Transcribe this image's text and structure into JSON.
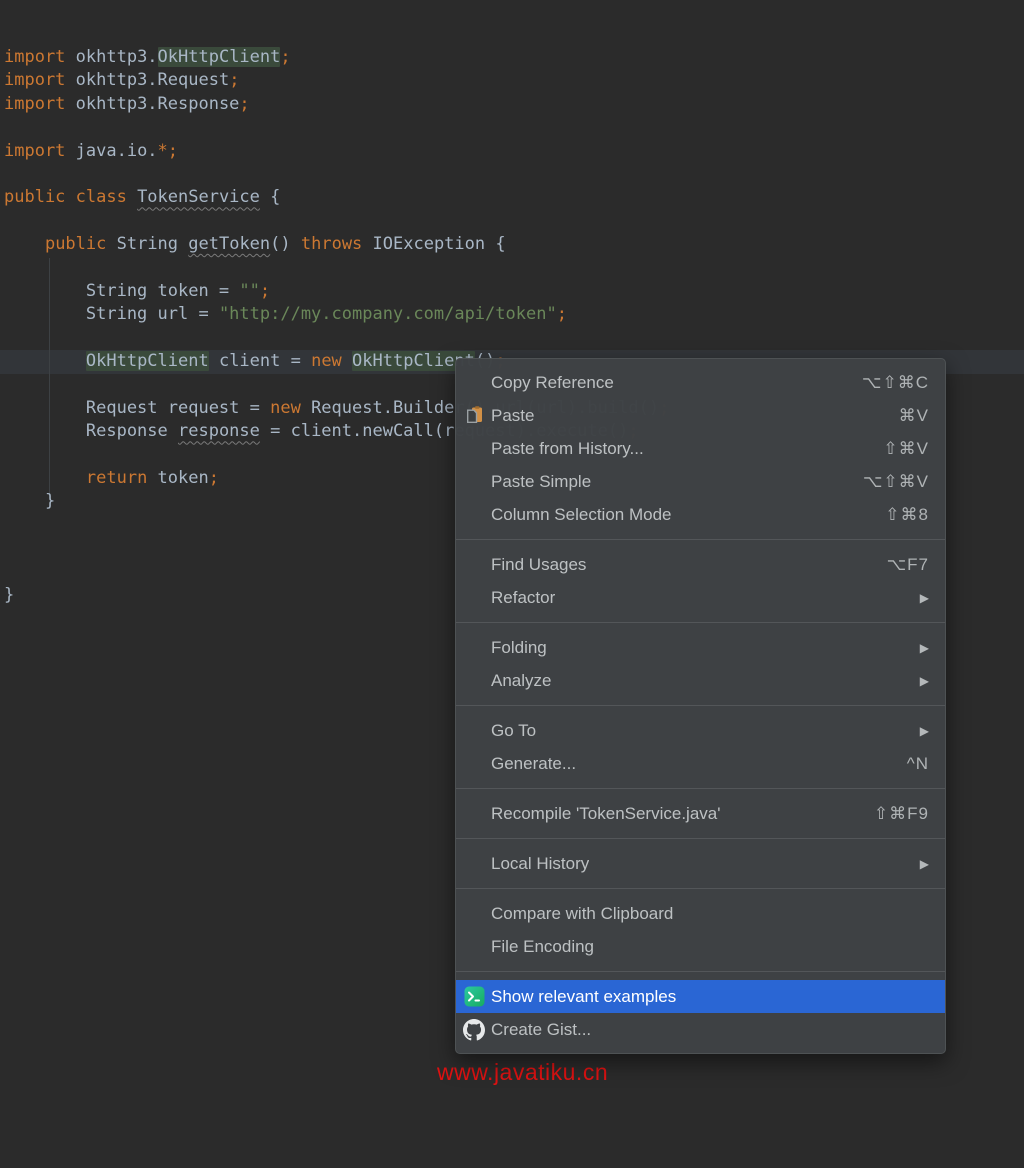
{
  "editor": {
    "background": "#2b2b2b",
    "caret_line_index": 13,
    "highlight_color": "#3a4a3b",
    "lines": [
      {
        "segments": [
          {
            "t": "import ",
            "c": "k"
          },
          {
            "t": "okhttp3.",
            "c": "p"
          },
          {
            "t": "OkHttpClient",
            "c": "p",
            "occ": true
          },
          {
            "t": ";",
            "c": "k"
          }
        ]
      },
      {
        "segments": [
          {
            "t": "import ",
            "c": "k"
          },
          {
            "t": "okhttp3.Request",
            "c": "p"
          },
          {
            "t": ";",
            "c": "k"
          }
        ]
      },
      {
        "segments": [
          {
            "t": "import ",
            "c": "k"
          },
          {
            "t": "okhttp3.Response",
            "c": "p"
          },
          {
            "t": ";",
            "c": "k"
          }
        ]
      },
      {
        "segments": []
      },
      {
        "segments": [
          {
            "t": "import ",
            "c": "k"
          },
          {
            "t": "java.io.",
            "c": "p"
          },
          {
            "t": "*;",
            "c": "k"
          }
        ]
      },
      {
        "segments": []
      },
      {
        "segments": [
          {
            "t": "public class ",
            "c": "k"
          },
          {
            "t": "TokenService",
            "c": "p",
            "wavy": true
          },
          {
            "t": " {",
            "c": "p"
          }
        ]
      },
      {
        "segments": []
      },
      {
        "segments": [
          {
            "t": "    ",
            "c": "p"
          },
          {
            "t": "public ",
            "c": "k"
          },
          {
            "t": "String ",
            "c": "p"
          },
          {
            "t": "getToken",
            "c": "p",
            "wavy": true
          },
          {
            "t": "() ",
            "c": "p"
          },
          {
            "t": "throws ",
            "c": "k"
          },
          {
            "t": "IOException {",
            "c": "p"
          }
        ]
      },
      {
        "segments": []
      },
      {
        "segments": [
          {
            "t": "        String token = ",
            "c": "p"
          },
          {
            "t": "\"\"",
            "c": "s"
          },
          {
            "t": ";",
            "c": "k"
          }
        ]
      },
      {
        "segments": [
          {
            "t": "        String url = ",
            "c": "p"
          },
          {
            "t": "\"http://my.company.com/api/token\"",
            "c": "s"
          },
          {
            "t": ";",
            "c": "k"
          }
        ]
      },
      {
        "segments": []
      },
      {
        "segments": [
          {
            "t": "        ",
            "c": "p"
          },
          {
            "t": "OkHttpClient",
            "c": "p",
            "occ": true
          },
          {
            "t": " client = ",
            "c": "p"
          },
          {
            "t": "new ",
            "c": "k"
          },
          {
            "t": "OkHttpClient",
            "c": "p",
            "occ": true
          },
          {
            "t": "()",
            "c": "p"
          },
          {
            "t": ";",
            "c": "k"
          }
        ]
      },
      {
        "segments": []
      },
      {
        "segments": [
          {
            "t": "        Request request = ",
            "c": "p"
          },
          {
            "t": "new ",
            "c": "k"
          },
          {
            "t": "Request.Builder().url(url).build()",
            "c": "p"
          },
          {
            "t": ";",
            "c": "k"
          }
        ]
      },
      {
        "segments": [
          {
            "t": "        Response ",
            "c": "p"
          },
          {
            "t": "response",
            "c": "p",
            "wavy": true
          },
          {
            "t": " = client.newCall(request).execute()",
            "c": "p"
          },
          {
            "t": ";",
            "c": "k"
          }
        ]
      },
      {
        "segments": []
      },
      {
        "segments": [
          {
            "t": "        ",
            "c": "p"
          },
          {
            "t": "return ",
            "c": "k"
          },
          {
            "t": "token",
            "c": "p"
          },
          {
            "t": ";",
            "c": "k"
          }
        ]
      },
      {
        "segments": [
          {
            "t": "    }",
            "c": "p"
          }
        ]
      },
      {
        "segments": []
      },
      {
        "segments": []
      },
      {
        "segments": []
      },
      {
        "segments": [
          {
            "t": "}",
            "c": "p"
          }
        ]
      }
    ]
  },
  "context_menu": {
    "selection_color": "#2a66d4",
    "groups": [
      {
        "items": [
          {
            "label": "Copy Reference",
            "shortcut": "⌥⇧⌘C"
          },
          {
            "label": "Paste",
            "icon": "paste-icon",
            "shortcut": "⌘V"
          },
          {
            "label": "Paste from History...",
            "shortcut": "⇧⌘V"
          },
          {
            "label": "Paste Simple",
            "shortcut": "⌥⇧⌘V"
          },
          {
            "label": "Column Selection Mode",
            "shortcut": "⇧⌘8"
          }
        ]
      },
      {
        "items": [
          {
            "label": "Find Usages",
            "shortcut": "⌥F7"
          },
          {
            "label": "Refactor",
            "submenu": true
          }
        ]
      },
      {
        "items": [
          {
            "label": "Folding",
            "submenu": true
          },
          {
            "label": "Analyze",
            "submenu": true
          }
        ]
      },
      {
        "items": [
          {
            "label": "Go To",
            "submenu": true
          },
          {
            "label": "Generate...",
            "shortcut": "^N"
          }
        ]
      },
      {
        "items": [
          {
            "label": "Recompile 'TokenService.java'",
            "shortcut": "⇧⌘F9"
          }
        ]
      },
      {
        "items": [
          {
            "label": "Local History",
            "submenu": true
          }
        ]
      },
      {
        "items": [
          {
            "label": "Compare with Clipboard"
          },
          {
            "label": "File Encoding"
          }
        ]
      },
      {
        "items": [
          {
            "label": "Show relevant examples",
            "icon": "terminal-icon",
            "selected": true
          },
          {
            "label": "Create Gist...",
            "icon": "github-icon"
          }
        ]
      }
    ]
  },
  "watermark": {
    "text": "www.javatiku.cn",
    "color": "#de1212"
  }
}
